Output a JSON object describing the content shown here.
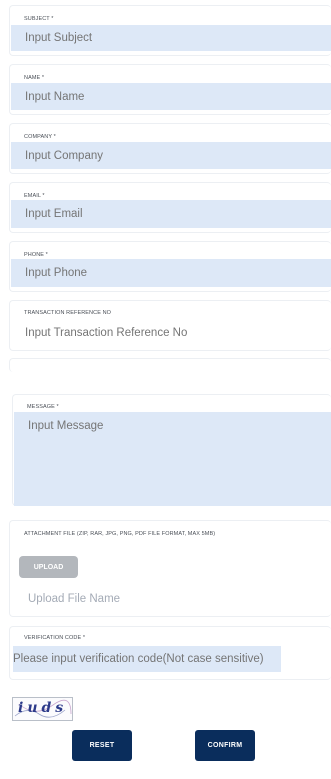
{
  "form": {
    "subject": {
      "label": "SUBJECT *",
      "placeholder": "Input Subject"
    },
    "name": {
      "label": "NAME *",
      "placeholder": "Input Name"
    },
    "company": {
      "label": "COMPANY *",
      "placeholder": "Input Company"
    },
    "email": {
      "label": "EMAIL *",
      "placeholder": "Input Email"
    },
    "phone": {
      "label": "PHONE *",
      "placeholder": "Input Phone"
    },
    "transaction": {
      "label": "TRANSACTION REFERENCE NO",
      "placeholder": "Input Transaction Reference No"
    },
    "message": {
      "label": "MESSAGE *",
      "placeholder": "Input Message"
    },
    "attachment": {
      "label": "ATTACHMENT FILE (ZIP, RAR, JPG, PNG, PDF FILE FORMAT, MAX 5MB)",
      "upload_label": "UPLOAD",
      "file_placeholder": "Upload File Name"
    },
    "verification": {
      "label": "VERIFICATION CODE *",
      "placeholder": "Please input verification code(Not case sensitive)",
      "captcha_text": "iuds"
    }
  },
  "actions": {
    "reset_label": "RESET",
    "confirm_label": "CONFIRM"
  },
  "colors": {
    "input_bg": "#dde8f7",
    "button_bg": "#0a2d5c",
    "upload_bg": "#b3b7bc"
  }
}
